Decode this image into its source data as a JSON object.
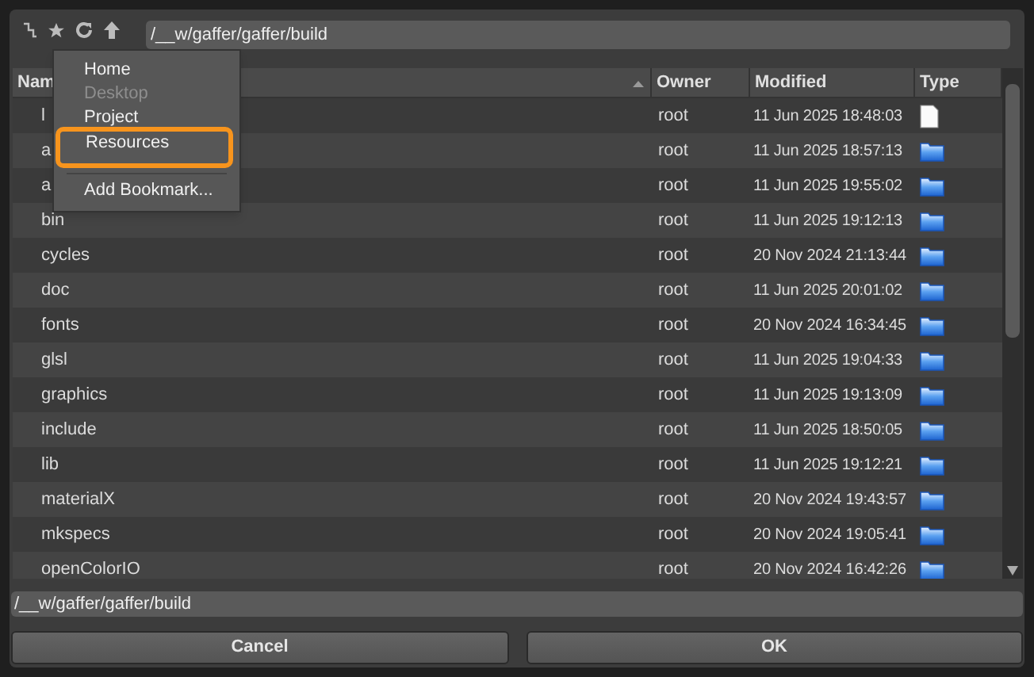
{
  "toolbar": {
    "path": "/__w/gaffer/gaffer/build"
  },
  "bookmarks_menu": {
    "items": [
      {
        "kind": "item",
        "label": "Home",
        "disabled": false,
        "highlighted": false
      },
      {
        "kind": "item",
        "label": "Desktop",
        "disabled": true,
        "highlighted": false
      },
      {
        "kind": "item",
        "label": "Project",
        "disabled": false,
        "highlighted": false
      },
      {
        "kind": "item",
        "label": "Resources",
        "disabled": false,
        "highlighted": true
      },
      {
        "kind": "separator"
      },
      {
        "kind": "item",
        "label": "Add Bookmark...",
        "disabled": false,
        "highlighted": false
      }
    ]
  },
  "table": {
    "columns": [
      {
        "label": "Nam",
        "sorted": true
      },
      {
        "label": "Owner",
        "sorted": false
      },
      {
        "label": "Modified",
        "sorted": false
      },
      {
        "label": "Type",
        "sorted": false
      }
    ],
    "rows": [
      {
        "name": "l",
        "owner": "root",
        "modified": "11 Jun 2025 18:48:03",
        "kind": "file"
      },
      {
        "name": "a",
        "owner": "root",
        "modified": "11 Jun 2025 18:57:13",
        "kind": "folder"
      },
      {
        "name": "a",
        "owner": "root",
        "modified": "11 Jun 2025 19:55:02",
        "kind": "folder"
      },
      {
        "name": "bin",
        "owner": "root",
        "modified": "11 Jun 2025 19:12:13",
        "kind": "folder"
      },
      {
        "name": "cycles",
        "owner": "root",
        "modified": "20 Nov 2024 21:13:44",
        "kind": "folder"
      },
      {
        "name": "doc",
        "owner": "root",
        "modified": "11 Jun 2025 20:01:02",
        "kind": "folder"
      },
      {
        "name": "fonts",
        "owner": "root",
        "modified": "20 Nov 2024 16:34:45",
        "kind": "folder"
      },
      {
        "name": "glsl",
        "owner": "root",
        "modified": "11 Jun 2025 19:04:33",
        "kind": "folder"
      },
      {
        "name": "graphics",
        "owner": "root",
        "modified": "11 Jun 2025 19:13:09",
        "kind": "folder"
      },
      {
        "name": "include",
        "owner": "root",
        "modified": "11 Jun 2025 18:50:05",
        "kind": "folder"
      },
      {
        "name": "lib",
        "owner": "root",
        "modified": "11 Jun 2025 19:12:21",
        "kind": "folder"
      },
      {
        "name": "materialX",
        "owner": "root",
        "modified": "20 Nov 2024 19:43:57",
        "kind": "folder"
      },
      {
        "name": "mkspecs",
        "owner": "root",
        "modified": "20 Nov 2024 19:05:41",
        "kind": "folder"
      },
      {
        "name": "openColorIO",
        "owner": "root",
        "modified": "20 Nov 2024 16:42:26",
        "kind": "folder"
      }
    ]
  },
  "path_field": {
    "value": "/__w/gaffer/gaffer/build"
  },
  "buttons": [
    {
      "label": "Cancel"
    },
    {
      "label": "OK"
    }
  ]
}
